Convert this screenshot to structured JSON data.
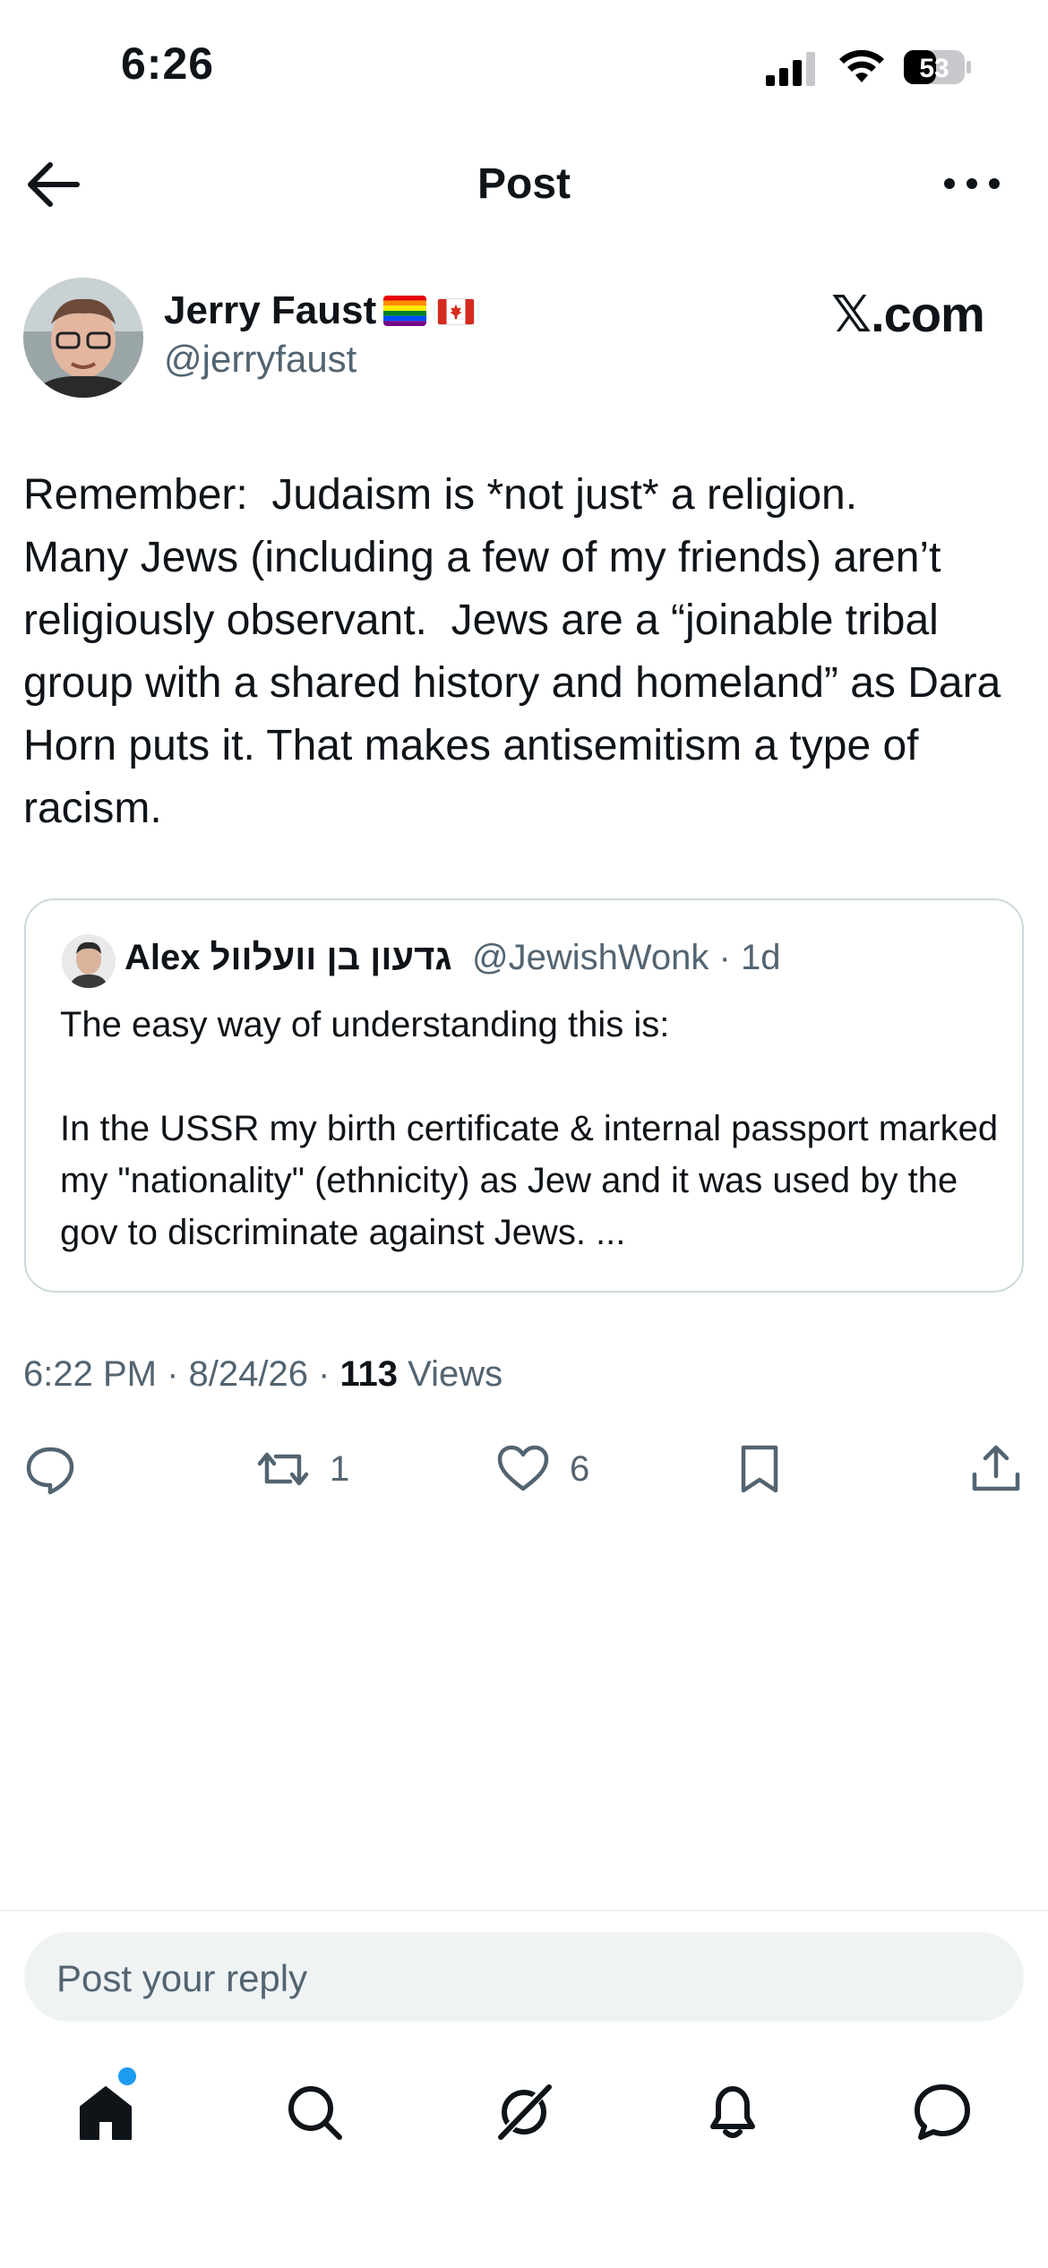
{
  "status_bar": {
    "time": "6:26",
    "battery": "53"
  },
  "header": {
    "title": "Post",
    "back_icon": "arrow-left-icon",
    "more_icon": "more-horizontal-icon"
  },
  "author": {
    "name": "Jerry Faust",
    "handle": "@jerryfaust",
    "flags": [
      "rainbow-flag",
      "canada-flag"
    ]
  },
  "watermark": "𝕏.com",
  "tweet": {
    "text": "Remember:  Judaism is *not just* a religion.\nMany Jews (including a few of my friends) aren’t religiously observant.  Jews are a “joinable tribal group with a shared history and homeland” as Dara Horn puts it. That makes antisemitism a type of racism."
  },
  "quote": {
    "name": "Alex גדעון בן וועלוול",
    "handle_time": "@JewishWonk · 1d",
    "text": "The easy way of understanding this is:\n\nIn the USSR my birth certificate & internal passport marked my \"nationality\" (ethnicity) as Jew and it was used by the gov to discriminate against Jews. ..."
  },
  "meta": {
    "time_date": "6:22 PM · 8/24/26 · ",
    "views_count": "113",
    "views_label": " Views"
  },
  "actions": {
    "reply_count": "",
    "repost_count": "1",
    "like_count": "6"
  },
  "reply": {
    "placeholder": "Post your reply"
  },
  "bottom_nav": [
    "home-icon",
    "search-icon",
    "grok-icon",
    "notifications-icon",
    "messages-icon"
  ],
  "colors": {
    "text": "#0f1419",
    "secondary": "#536471",
    "accent": "#1d9bf0",
    "border": "#cfd9de"
  }
}
